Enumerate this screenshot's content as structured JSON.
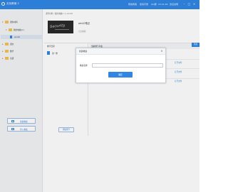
{
  "app": {
    "title": "无忧教案 2",
    "accent": "#2f86e4"
  },
  "topbar": {
    "links": [
      "帮助教程",
      "使用手册",
      "QQ群",
      "V3.01.66",
      "激活说明"
    ],
    "window_buttons": [
      "minimize-icon",
      "maximize-icon",
      "close-icon"
    ]
  },
  "sidebar": {
    "tree": [
      {
        "label": "课件材料",
        "type": "folder"
      },
      {
        "label": "我的电脑(c:)",
        "type": "folder"
      },
      {
        "label": "win10",
        "type": "doc"
      },
      {
        "label": "语文",
        "type": "folder"
      },
      {
        "label": "数学",
        "type": "folder"
      },
      {
        "label": "英语",
        "type": "folder"
      }
    ],
    "buttons": [
      {
        "label": "新建教案"
      },
      {
        "label": "导入教案"
      }
    ]
  },
  "main": {
    "breadcrumb": "课件材料 / 我的电脑(c:) / win10",
    "cover_text": "Security",
    "book_title": "win10笔记",
    "book_edit": "点击编辑",
    "chapters_header": "章节目录",
    "chapters": [
      {
        "label": "第一章"
      }
    ],
    "add_chapter": "添加章节",
    "table_header": "当前章节列表",
    "row_links": [
      "打开文件",
      "打开文件",
      "打开文件"
    ],
    "right_tag": "添加"
  },
  "dialog": {
    "title": "新建教案",
    "field_label": "教案名称",
    "field_value": "",
    "field_placeholder": "",
    "ok_label": "确定",
    "close_icon": "close-icon"
  }
}
